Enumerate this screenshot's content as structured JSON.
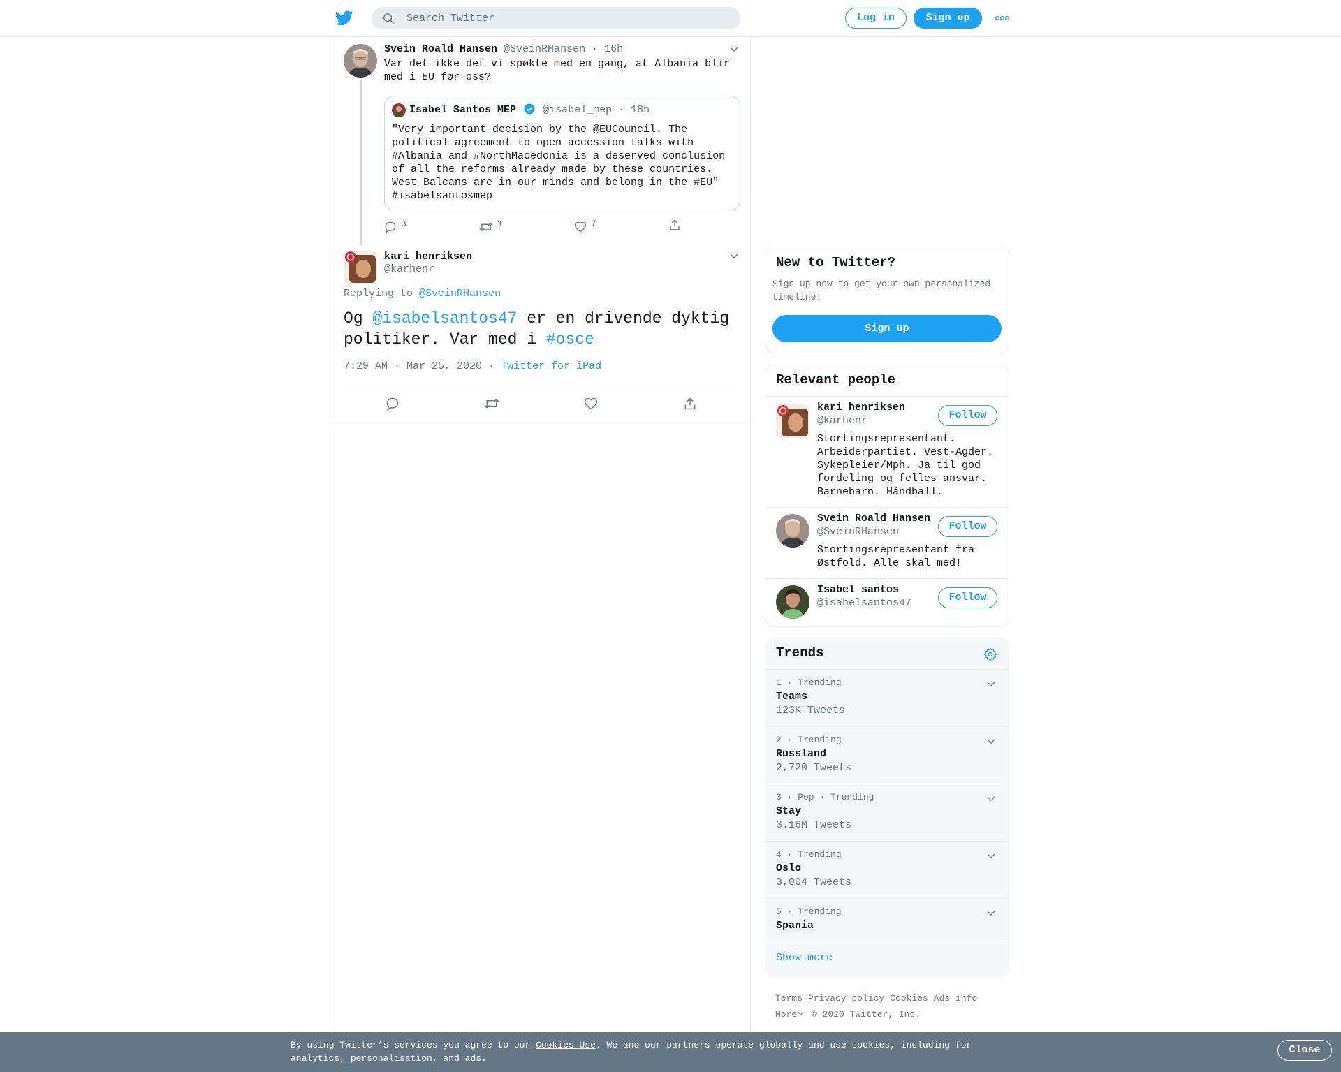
{
  "topbar": {
    "search_placeholder": "Search Twitter",
    "login_label": "Log in",
    "signup_label": "Sign up"
  },
  "tweet1": {
    "name": "Svein Roald Hansen",
    "handle": "@SveinRHansen",
    "time": "16h",
    "text": "Var det ikke det vi spøkte med en gang, at Albania blir med i EU før oss?",
    "quote": {
      "name": "Isabel Santos MEP",
      "handle": "@isabel_mep",
      "time": "18h",
      "text": "\"Very important decision by the @EUCouncil. The political agreement to open accession talks with #Albania and #NorthMacedonia is a deserved conclusion of all the reforms already made by these countries. West Balcans are in our minds and belong in the #EU\" #isabelsantosmep"
    },
    "replies": "3",
    "retweets": "1",
    "likes": "7"
  },
  "tweet2": {
    "name": "kari henriksen",
    "handle": "@karhenr",
    "replying_label": "Replying to",
    "replying_to": "@SveinRHansen",
    "text_pre": "Og ",
    "mention": "@isabelsantos47",
    "text_mid": " er en drivende dyktig politiker. Var med i ",
    "hashtag": "#osce",
    "timestamp": "7:29 AM · Mar 25, 2020",
    "source": "Twitter for iPad"
  },
  "new_to_twitter": {
    "title": "New to Twitter?",
    "subtitle": "Sign up now to get your own personalized timeline!",
    "signup_label": "Sign up"
  },
  "relevant_people": {
    "title": "Relevant people",
    "follow_label": "Follow",
    "people": [
      {
        "name": "kari henriksen",
        "handle": "@karhenr",
        "bio": "Stortingsrepresentant. Arbeiderpartiet. Vest-Agder. Sykepleier/Mph. Ja til god fordeling og felles ansvar. Barnebarn. Håndball."
      },
      {
        "name": "Svein Roald Hansen",
        "handle": "@SveinRHansen",
        "bio": "Stortingsrepresentant fra Østfold. Alle skal med!"
      },
      {
        "name": "Isabel santos",
        "handle": "@isabelsantos47",
        "bio": ""
      }
    ]
  },
  "trends": {
    "title": "Trends",
    "items": [
      {
        "meta": "1 · Trending",
        "name": "Teams",
        "count": "123K Tweets"
      },
      {
        "meta": "2 · Trending",
        "name": "Russland",
        "count": "2,720 Tweets"
      },
      {
        "meta": "3 · Pop · Trending",
        "name": "Stay",
        "count": "3.16M Tweets"
      },
      {
        "meta": "4 · Trending",
        "name": "Oslo",
        "count": "3,004 Tweets"
      },
      {
        "meta": "5 · Trending",
        "name": "Spania",
        "count": ""
      }
    ],
    "show_more": "Show more"
  },
  "footer": {
    "terms": "Terms",
    "privacy": "Privacy policy",
    "cookies": "Cookies",
    "ads": "Ads info",
    "more": "More",
    "copyright": "© 2020 Twitter, Inc."
  },
  "cookie_bar": {
    "text_pre": "By using Twitter’s services you agree to our ",
    "link": "Cookies Use",
    "text_post": ". We and our partners operate globally and use cookies, including for analytics, personalisation, and ads.",
    "close_label": "Close"
  },
  "colors": {
    "accent": "#1da1f2",
    "secondary_text": "#657786",
    "border": "#e6ecf0"
  }
}
